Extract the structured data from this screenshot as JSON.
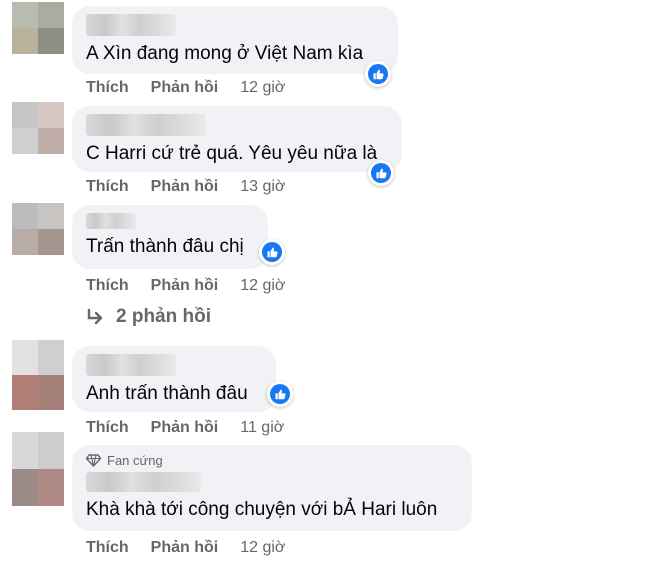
{
  "comments": [
    {
      "text": "A Xìn đang mong ở Việt Nam kìa",
      "like_label": "Thích",
      "reply_label": "Phản hồi",
      "time": "12 giờ"
    },
    {
      "text": "C Harri cứ trẻ quá. Yêu yêu nữa là",
      "like_label": "Thích",
      "reply_label": "Phản hồi",
      "time": "13 giờ"
    },
    {
      "text": "Trấn thành đâu chị",
      "like_label": "Thích",
      "reply_label": "Phản hồi",
      "time": "12 giờ"
    },
    {
      "text": "Anh trấn thành đâu",
      "like_label": "Thích",
      "reply_label": "Phản hồi",
      "time": "11 giờ"
    },
    {
      "text": "Khà khà tới công chuyện với bẢ Hari luôn",
      "badge": "Fan cứng",
      "like_label": "Thích",
      "reply_label": "Phản hồi",
      "time": "12 giờ"
    }
  ],
  "replies_link": "2 phản hồi",
  "colors": {
    "bubble": "#f0f2f5",
    "like_blue": "#1877f2",
    "meta_gray": "#65676b"
  },
  "icons": [
    "like-reaction-icon",
    "reply-arrow-icon",
    "diamond-icon"
  ]
}
